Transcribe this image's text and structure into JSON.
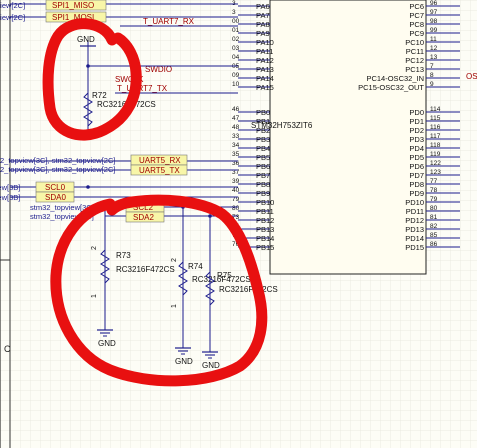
{
  "chip": {
    "name": "STM32H753ZIT6",
    "left_top_pins": [
      "PA4",
      "PA5",
      "PA6",
      "PA7",
      "PA8",
      "PA9",
      "PA10",
      "PA11",
      "PA12",
      "PA13",
      "PA14",
      "PA15"
    ],
    "left_top_nums": [
      "",
      "",
      "3",
      "3",
      "00",
      "01",
      "02",
      "03",
      "04",
      "05",
      "09",
      "10"
    ],
    "left_bottom_pins": [
      "PB0",
      "PB1",
      "PB2",
      "PB3",
      "PB4",
      "PB5",
      "PB6",
      "PB7",
      "PB8",
      "PB9",
      "PB10",
      "PB11",
      "PB12",
      "PB13",
      "PB14",
      "PB15"
    ],
    "left_bottom_nums": [
      "46",
      "47",
      "48",
      "33",
      "34",
      "35",
      "36",
      "37",
      "39",
      "40",
      "79",
      "80",
      "73",
      "74",
      "75",
      "76"
    ],
    "right_top_pins": [
      "PC4",
      "PC5",
      "PC6",
      "PC7",
      "PC8",
      "PC9",
      "PC10",
      "PC11",
      "PC12",
      "PC13",
      "PC14-OSC32_IN",
      "PC15-OSC32_OUT"
    ],
    "right_top_nums": [
      "",
      "",
      "96",
      "97",
      "98",
      "99",
      "11",
      "12",
      "13",
      "7",
      "8",
      "9"
    ],
    "right_bottom_pins": [
      "PD0",
      "PD1",
      "PD2",
      "PD3",
      "PD4",
      "PD5",
      "PD6",
      "PD7",
      "PD8",
      "PD9",
      "PD10",
      "PD11",
      "PD12",
      "PD13",
      "PD14",
      "PD15"
    ],
    "right_bottom_nums": [
      "114",
      "115",
      "116",
      "117",
      "118",
      "119",
      "122",
      "123",
      "77",
      "78",
      "79",
      "80",
      "81",
      "82",
      "85",
      "86"
    ]
  },
  "net_labels": {
    "spi1_miso": "SPI1_MISO",
    "spi1_mosi": "SPI1_MOSI",
    "uart7_rx": "T_UART7_RX",
    "swdio": "SWDIO",
    "swclk": "SWCLK",
    "uart7_tx": "T_UART7_TX",
    "uart5_rx": "UART5_RX",
    "uart5_tx": "UART5_TX",
    "scl0": "SCL0",
    "sda0": "SDA0",
    "scl2": "SCL2",
    "sda2": "SDA2",
    "os": "OS"
  },
  "sheet_refs": {
    "topview_2c_a": "topview[2C]",
    "topview_2c_b": "topview[2C]",
    "uart5_rx_ref": "2_topview[3C], stm32_topview[2C]",
    "uart5_tx_ref": "2_topview[3C], stm32_topview[2C]",
    "scl0_ref": "view[3B]",
    "sda0_ref": "view[3B]",
    "scl2_ref": "stm32_topview[3C]",
    "sda2_ref": "stm32_topview[3C]"
  },
  "components": {
    "gnd_label": "GND",
    "r72": {
      "ref": "R72",
      "part": "RC3216F472CS",
      "pins": [
        "2",
        "1"
      ]
    },
    "r73": {
      "ref": "R73",
      "part": "RC3216F472CS",
      "pins": [
        "2",
        "1"
      ]
    },
    "r74": {
      "ref": "R74",
      "part": "RC3216F472CS",
      "pins": [
        "2",
        "1"
      ]
    },
    "r75": {
      "ref": "R75",
      "part": "RC3216F472CS",
      "pins": [
        "2",
        "1"
      ]
    }
  },
  "border": {
    "zone_c": "C"
  },
  "colors": {
    "wire": "#1c1c8c",
    "pin_text": "#111111",
    "label_fill": "#f8f6a8",
    "label_text": "#a00000",
    "chip_fill": "#fffdf0",
    "annotation": "#e81010",
    "grid": "#e6e6dc"
  },
  "annotation": "red freehand circles around GND resistors"
}
